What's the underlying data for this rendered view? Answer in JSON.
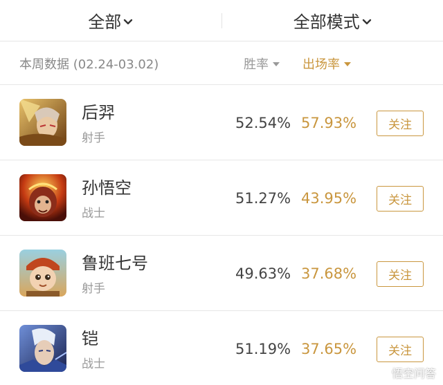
{
  "header": {
    "filter_left": "全部",
    "filter_right": "全部模式"
  },
  "subheader": {
    "period": "本周数据 (02.24-03.02)",
    "sort_win": "胜率",
    "sort_pick": "出场率"
  },
  "colors": {
    "accent": "#c9963e",
    "text": "#333333",
    "muted": "#999999",
    "divider": "#e6e6e6"
  },
  "heroes": [
    {
      "name": "后羿",
      "role": "射手",
      "win_rate": "52.54%",
      "pick_rate": "57.93%",
      "follow_label": "关注"
    },
    {
      "name": "孙悟空",
      "role": "战士",
      "win_rate": "51.27%",
      "pick_rate": "43.95%",
      "follow_label": "关注"
    },
    {
      "name": "鲁班七号",
      "role": "射手",
      "win_rate": "49.63%",
      "pick_rate": "37.68%",
      "follow_label": "关注"
    },
    {
      "name": "铠",
      "role": "战士",
      "win_rate": "51.19%",
      "pick_rate": "37.65%",
      "follow_label": "关注"
    }
  ],
  "watermark": {
    "text": "悟空问答",
    "icon": "wukong-logo-icon"
  }
}
